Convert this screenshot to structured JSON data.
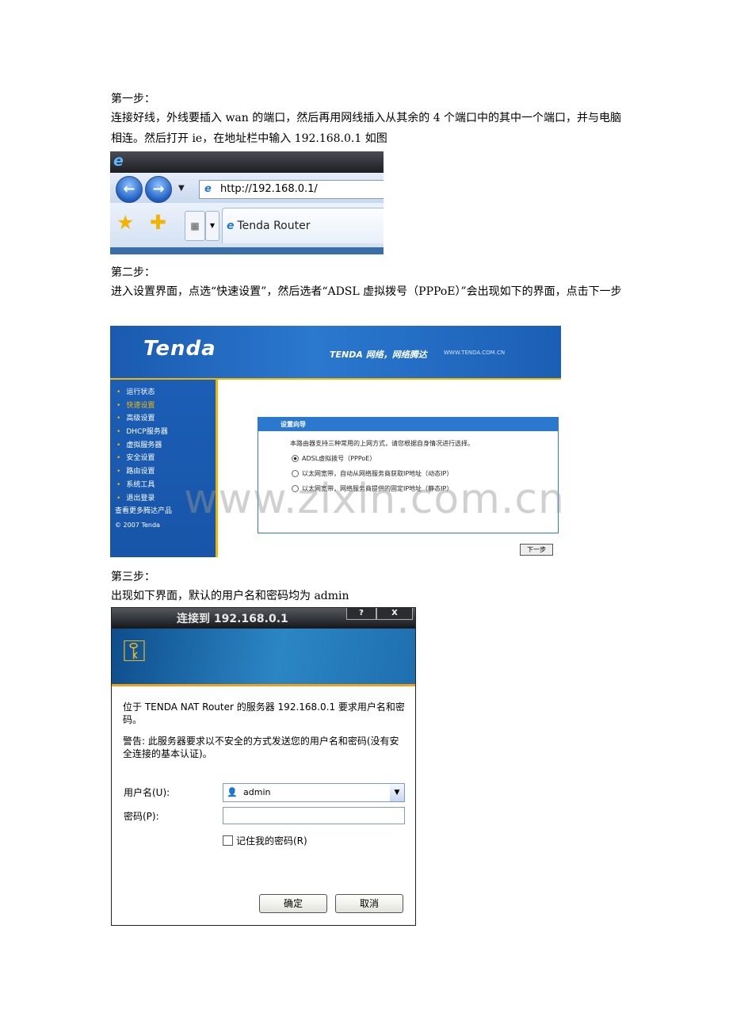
{
  "step1": {
    "title": "第一步：",
    "text": "连接好线，外线要插入 wan  的端口，然后再用网线插入从其余的 4 个端口中的其中一个端口，并与电脑相连。然后打开 ie，在地址栏中输入 192.168.0.1  如图"
  },
  "ie_screenshot": {
    "address": "http://192.168.0.1/",
    "tab_title": "Tenda Router",
    "tab_close": "×"
  },
  "step2": {
    "title": "第二步：",
    "text": "进入设置界面，点选“快速设置”，然后选者“ADSL 虚拟拨号（PPPoE）”会出现如下的界面，点击下一步"
  },
  "tenda_screenshot": {
    "logo": "Tenda",
    "slogan": "TENDA 网络，网络腾达",
    "url": "WWW.TENDA.COM.CN",
    "menu": [
      "运行状态",
      "快速设置",
      "高级设置",
      "DHCP服务器",
      "虚拟服务器",
      "安全设置",
      "路由设置",
      "系统工具",
      "退出登录"
    ],
    "active_menu": "快速设置",
    "more": "查看更多腾达产品",
    "copyright": "© 2007 Tenda",
    "wizard_title": "设置向导",
    "wizard_desc": "本路由器支持三种常用的上网方式，请您根据自身情况进行选择。",
    "options": [
      "ADSL虚拟拨号（PPPoE）",
      "以太网宽带，自动从网络服务商获取IP地址（动态IP）",
      "以太网宽带，网络服务商提供的固定IP地址（静态IP）"
    ],
    "selected_option": "ADSL虚拟拨号（PPPoE）",
    "next_button": "下一步"
  },
  "watermark": "www.zixin.com.cn",
  "step3": {
    "title": "第三步：",
    "text": "出现如下界面，默认的用户名和密码均为  admin"
  },
  "login_dialog": {
    "title": "连接到 192.168.0.1",
    "help": "?",
    "close": "X",
    "message1": "位于 TENDA NAT Router 的服务器 192.168.0.1 要求用户名和密码。",
    "message2": "警告: 此服务器要求以不安全的方式发送您的用户名和密码(没有安全连接的基本认证)。",
    "username_label": "用户名(U):",
    "username_value": "admin",
    "password_label": "密码(P):",
    "remember_label": "记住我的密码(R)",
    "ok_button": "确定",
    "cancel_button": "取消"
  }
}
